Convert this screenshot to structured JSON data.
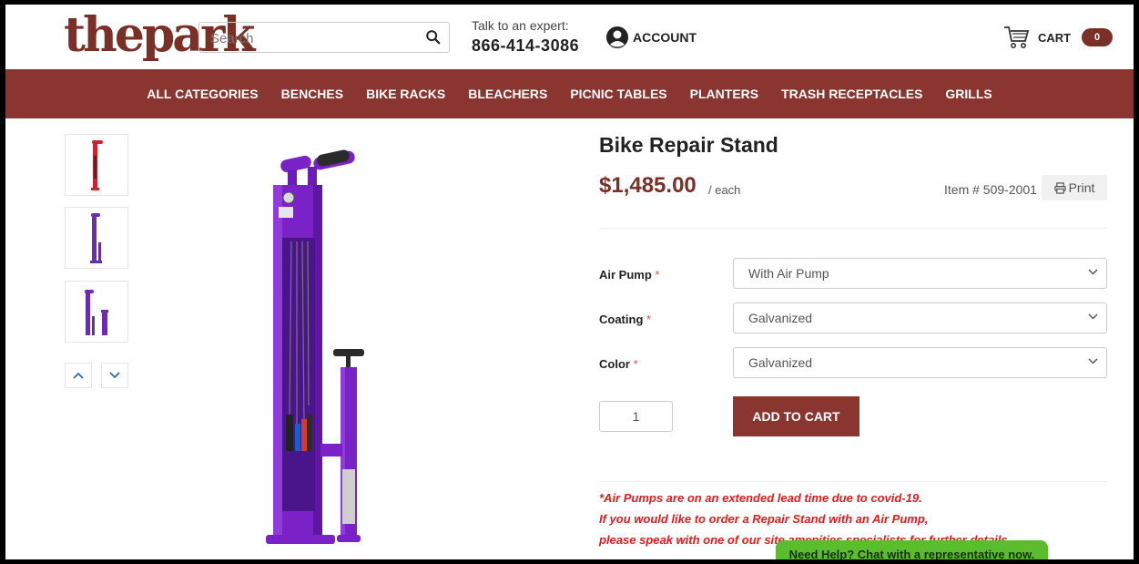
{
  "header": {
    "logo": "thepark",
    "search_placeholder": "Search",
    "expert_label": "Talk to an expert:",
    "expert_phone": "866-414-3086",
    "account_label": "ACCOUNT",
    "cart_label": "CART",
    "cart_count": "0"
  },
  "nav": {
    "items": [
      "ALL CATEGORIES",
      "BENCHES",
      "BIKE RACKS",
      "BLEACHERS",
      "PICNIC TABLES",
      "PLANTERS",
      "TRASH RECEPTACLES",
      "GRILLS"
    ]
  },
  "product": {
    "title": "Bike Repair Stand",
    "price": "$1,485.00",
    "per": "/ each",
    "item_number": "Item # 509-2001",
    "print_label": "Print",
    "options": [
      {
        "label": "Air Pump",
        "required": "*",
        "value": "With Air Pump"
      },
      {
        "label": "Coating",
        "required": "*",
        "value": "Galvanized"
      },
      {
        "label": "Color",
        "required": "*",
        "value": "Galvanized"
      }
    ],
    "quantity": "1",
    "add_to_cart_label": "ADD TO CART",
    "notices": [
      "*Air Pumps are on an extended lead time due to covid-19.",
      "If you would like to order a Repair Stand with an Air Pump,",
      "please speak with one of our site amenities specialists for further details."
    ]
  },
  "chat": {
    "label": "Need Help? Chat with a representative now."
  },
  "colors": {
    "brand": "#8a3530",
    "product": "#7a22c7",
    "chat": "#5bbc2e"
  }
}
